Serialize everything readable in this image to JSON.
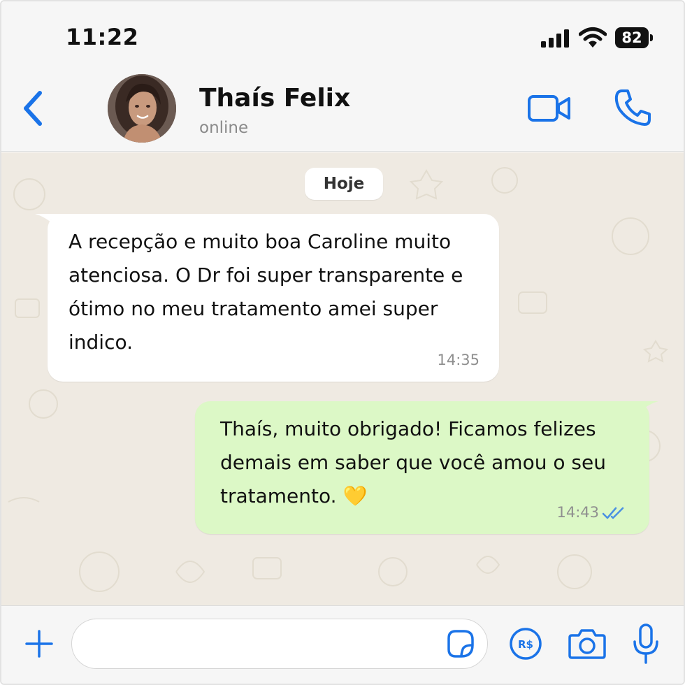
{
  "status_bar": {
    "time": "11:22",
    "battery": "82",
    "icons": [
      "signal-icon",
      "wifi-icon",
      "battery-icon"
    ]
  },
  "header": {
    "contact_name": "Thaís Felix",
    "contact_status": "online",
    "icons": [
      "back-chevron-icon",
      "video-call-icon",
      "phone-icon"
    ]
  },
  "chat": {
    "day_label": "Hoje",
    "messages": [
      {
        "direction": "incoming",
        "text": "A recepção e muito boa Caroline muito\natenciosa. O Dr foi super transparente e\nótimo no meu tratamento amei super\nindico.",
        "time": "14:35"
      },
      {
        "direction": "outgoing",
        "text": "Thaís, muito obrigado! Ficamos felizes\ndemais em saber que você amou o seu\ntratamento. 💛",
        "time": "14:43",
        "status": "read"
      }
    ]
  },
  "input_bar": {
    "value": "",
    "icons": [
      "plus-icon",
      "sticker-icon",
      "pix-icon",
      "camera-icon",
      "microphone-icon"
    ]
  },
  "colors": {
    "accent": "#1a73e8",
    "incoming_bubble": "#ffffff",
    "outgoing_bubble": "#dcf8c6",
    "chat_background": "#efeae2",
    "read_ticks": "#4a90e2"
  }
}
